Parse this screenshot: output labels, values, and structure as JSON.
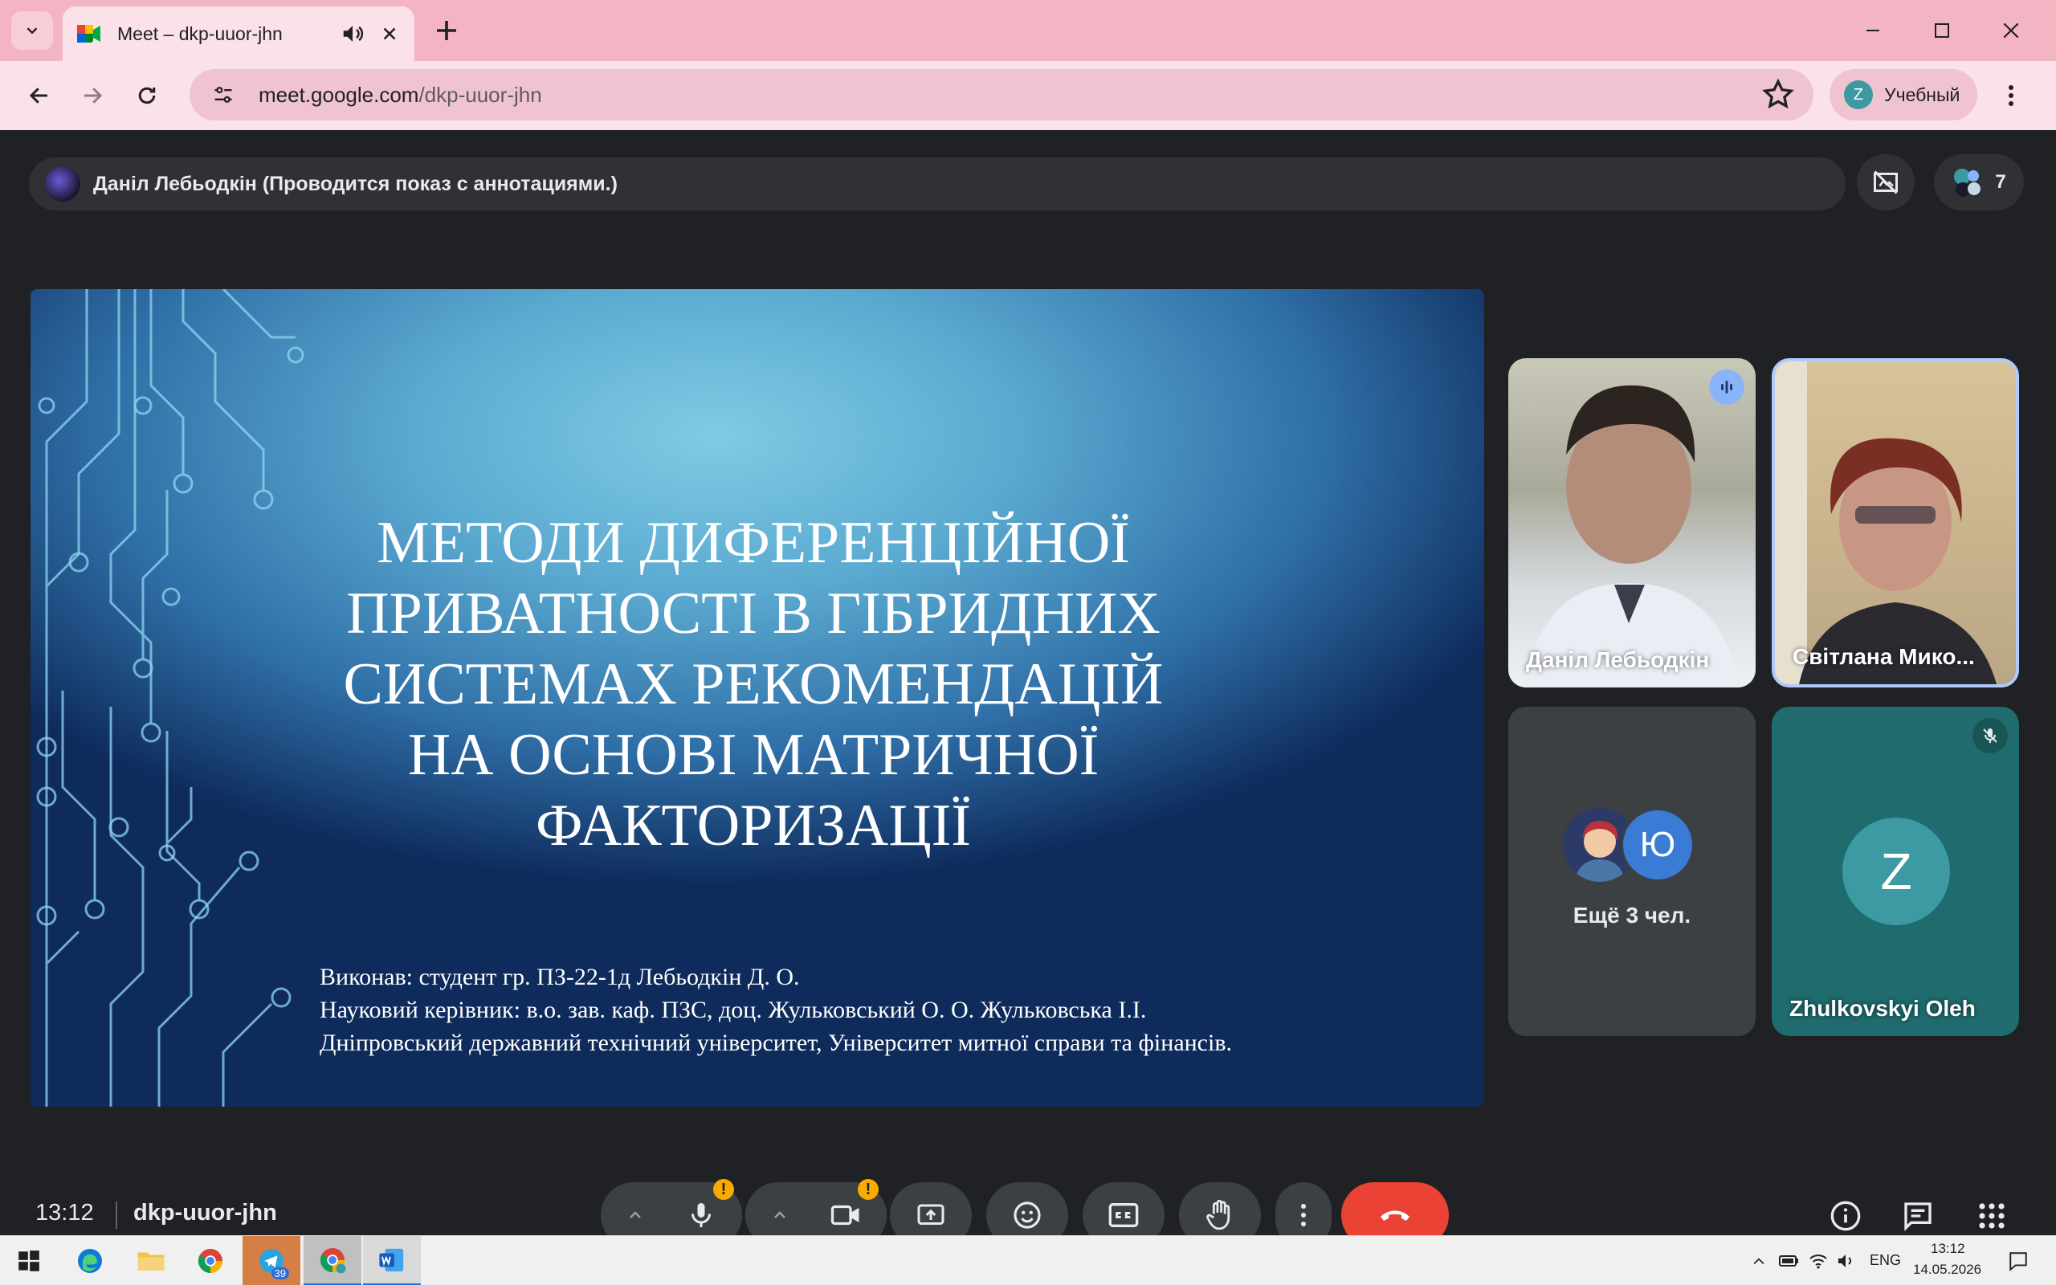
{
  "browser": {
    "tab_title": "Meet – dkp-uuor-jhn",
    "url_host": "meet.google.com",
    "url_path": "/dkp-uuor-jhn",
    "profile_initial": "Z",
    "profile_label": "Учебный"
  },
  "meet": {
    "presenter_text": "Даніл Лебьодкін (Проводится показ с аннотациями.)",
    "participant_count": "7",
    "time": "13:12",
    "meeting_code": "dkp-uuor-jhn"
  },
  "slide": {
    "title_lines": [
      "МЕТОДИ ДИФЕРЕНЦІЙНОЇ",
      "ПРИВАТНОСТІ В ГІБРИДНИХ",
      "СИСТЕМАХ РЕКОМЕНДАЦІЙ",
      "НА ОСНОВІ МАТРИЧНОЇ",
      "ФАКТОРИЗАЦІЇ"
    ],
    "info_lines": [
      "Виконав: студент гр. ПЗ-22-1д Лебьодкін Д. О.",
      "Науковий керівник: в.о. зав. каф. ПЗС, доц. Жульковський О. О. Жульковська І.І.",
      "Дніпровський державний технічний університет, Університет митної справи та фінансів."
    ]
  },
  "tiles": [
    {
      "name": "Даніл Лебьодкін"
    },
    {
      "name": "Світлана Мико..."
    },
    {
      "name": "Ещё 3 чел.",
      "avatar_letter": "Ю"
    },
    {
      "name": "Zhulkovskyi Oleh",
      "avatar_letter": "Z"
    }
  ],
  "controls": {
    "warn_symbol": "!"
  },
  "taskbar": {
    "telegram_badge": "39",
    "lang": "ENG",
    "time": "13:12",
    "date": "14.05.2026"
  },
  "colors": {
    "chrome_frame": "#f3b4c4",
    "meet_bg": "#202124",
    "end_call": "#ea4335",
    "warning": "#f9ab00",
    "teal_avatar": "#3d9aa3"
  }
}
